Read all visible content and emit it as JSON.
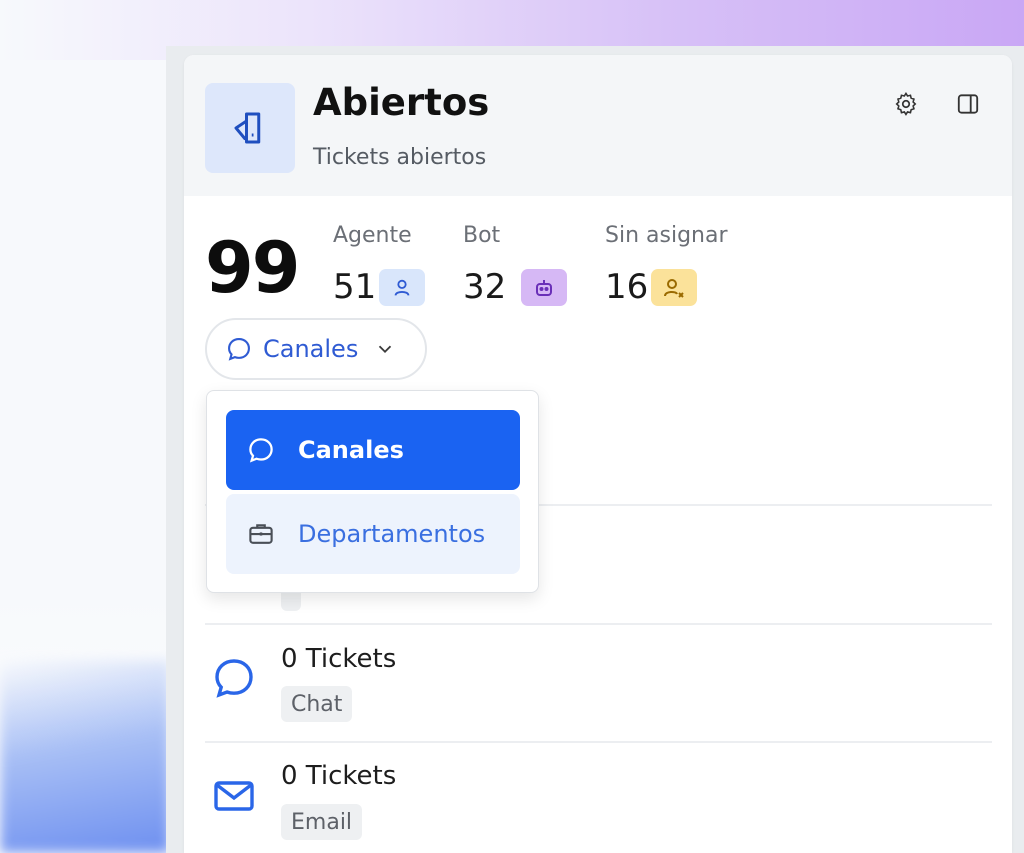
{
  "header": {
    "title": "Abiertos",
    "subtitle": "Tickets abiertos",
    "icon": "ticket-icon",
    "settings_icon": "gear-icon",
    "panel_icon": "sidebar-toggle-icon"
  },
  "stats": {
    "total": "99",
    "agent": {
      "label": "Agente",
      "value": "51",
      "icon": "user-icon",
      "color": "#d9e6fb"
    },
    "bot": {
      "label": "Bot",
      "value": "32",
      "icon": "bot-icon",
      "color": "#d6b8f5"
    },
    "unassigned": {
      "label": "Sin asignar",
      "value": "16",
      "icon": "user-x-icon",
      "color": "#fbe29a"
    }
  },
  "selector": {
    "label": "Canales",
    "icon": "chat-bubble-icon"
  },
  "dropdown": {
    "options": [
      {
        "label": "Canales",
        "icon": "chat-bubble-icon",
        "selected": true
      },
      {
        "label": "Departamentos",
        "icon": "briefcase-icon",
        "selected": false
      }
    ]
  },
  "channels": [
    {
      "count": "0 Tickets",
      "name": "Chat",
      "icon": "chat-bubble-icon"
    },
    {
      "count": "0 Tickets",
      "name": "Email",
      "icon": "mail-icon"
    }
  ],
  "colors": {
    "accent": "#1a63f2",
    "accent_text": "#2f5bd3"
  }
}
